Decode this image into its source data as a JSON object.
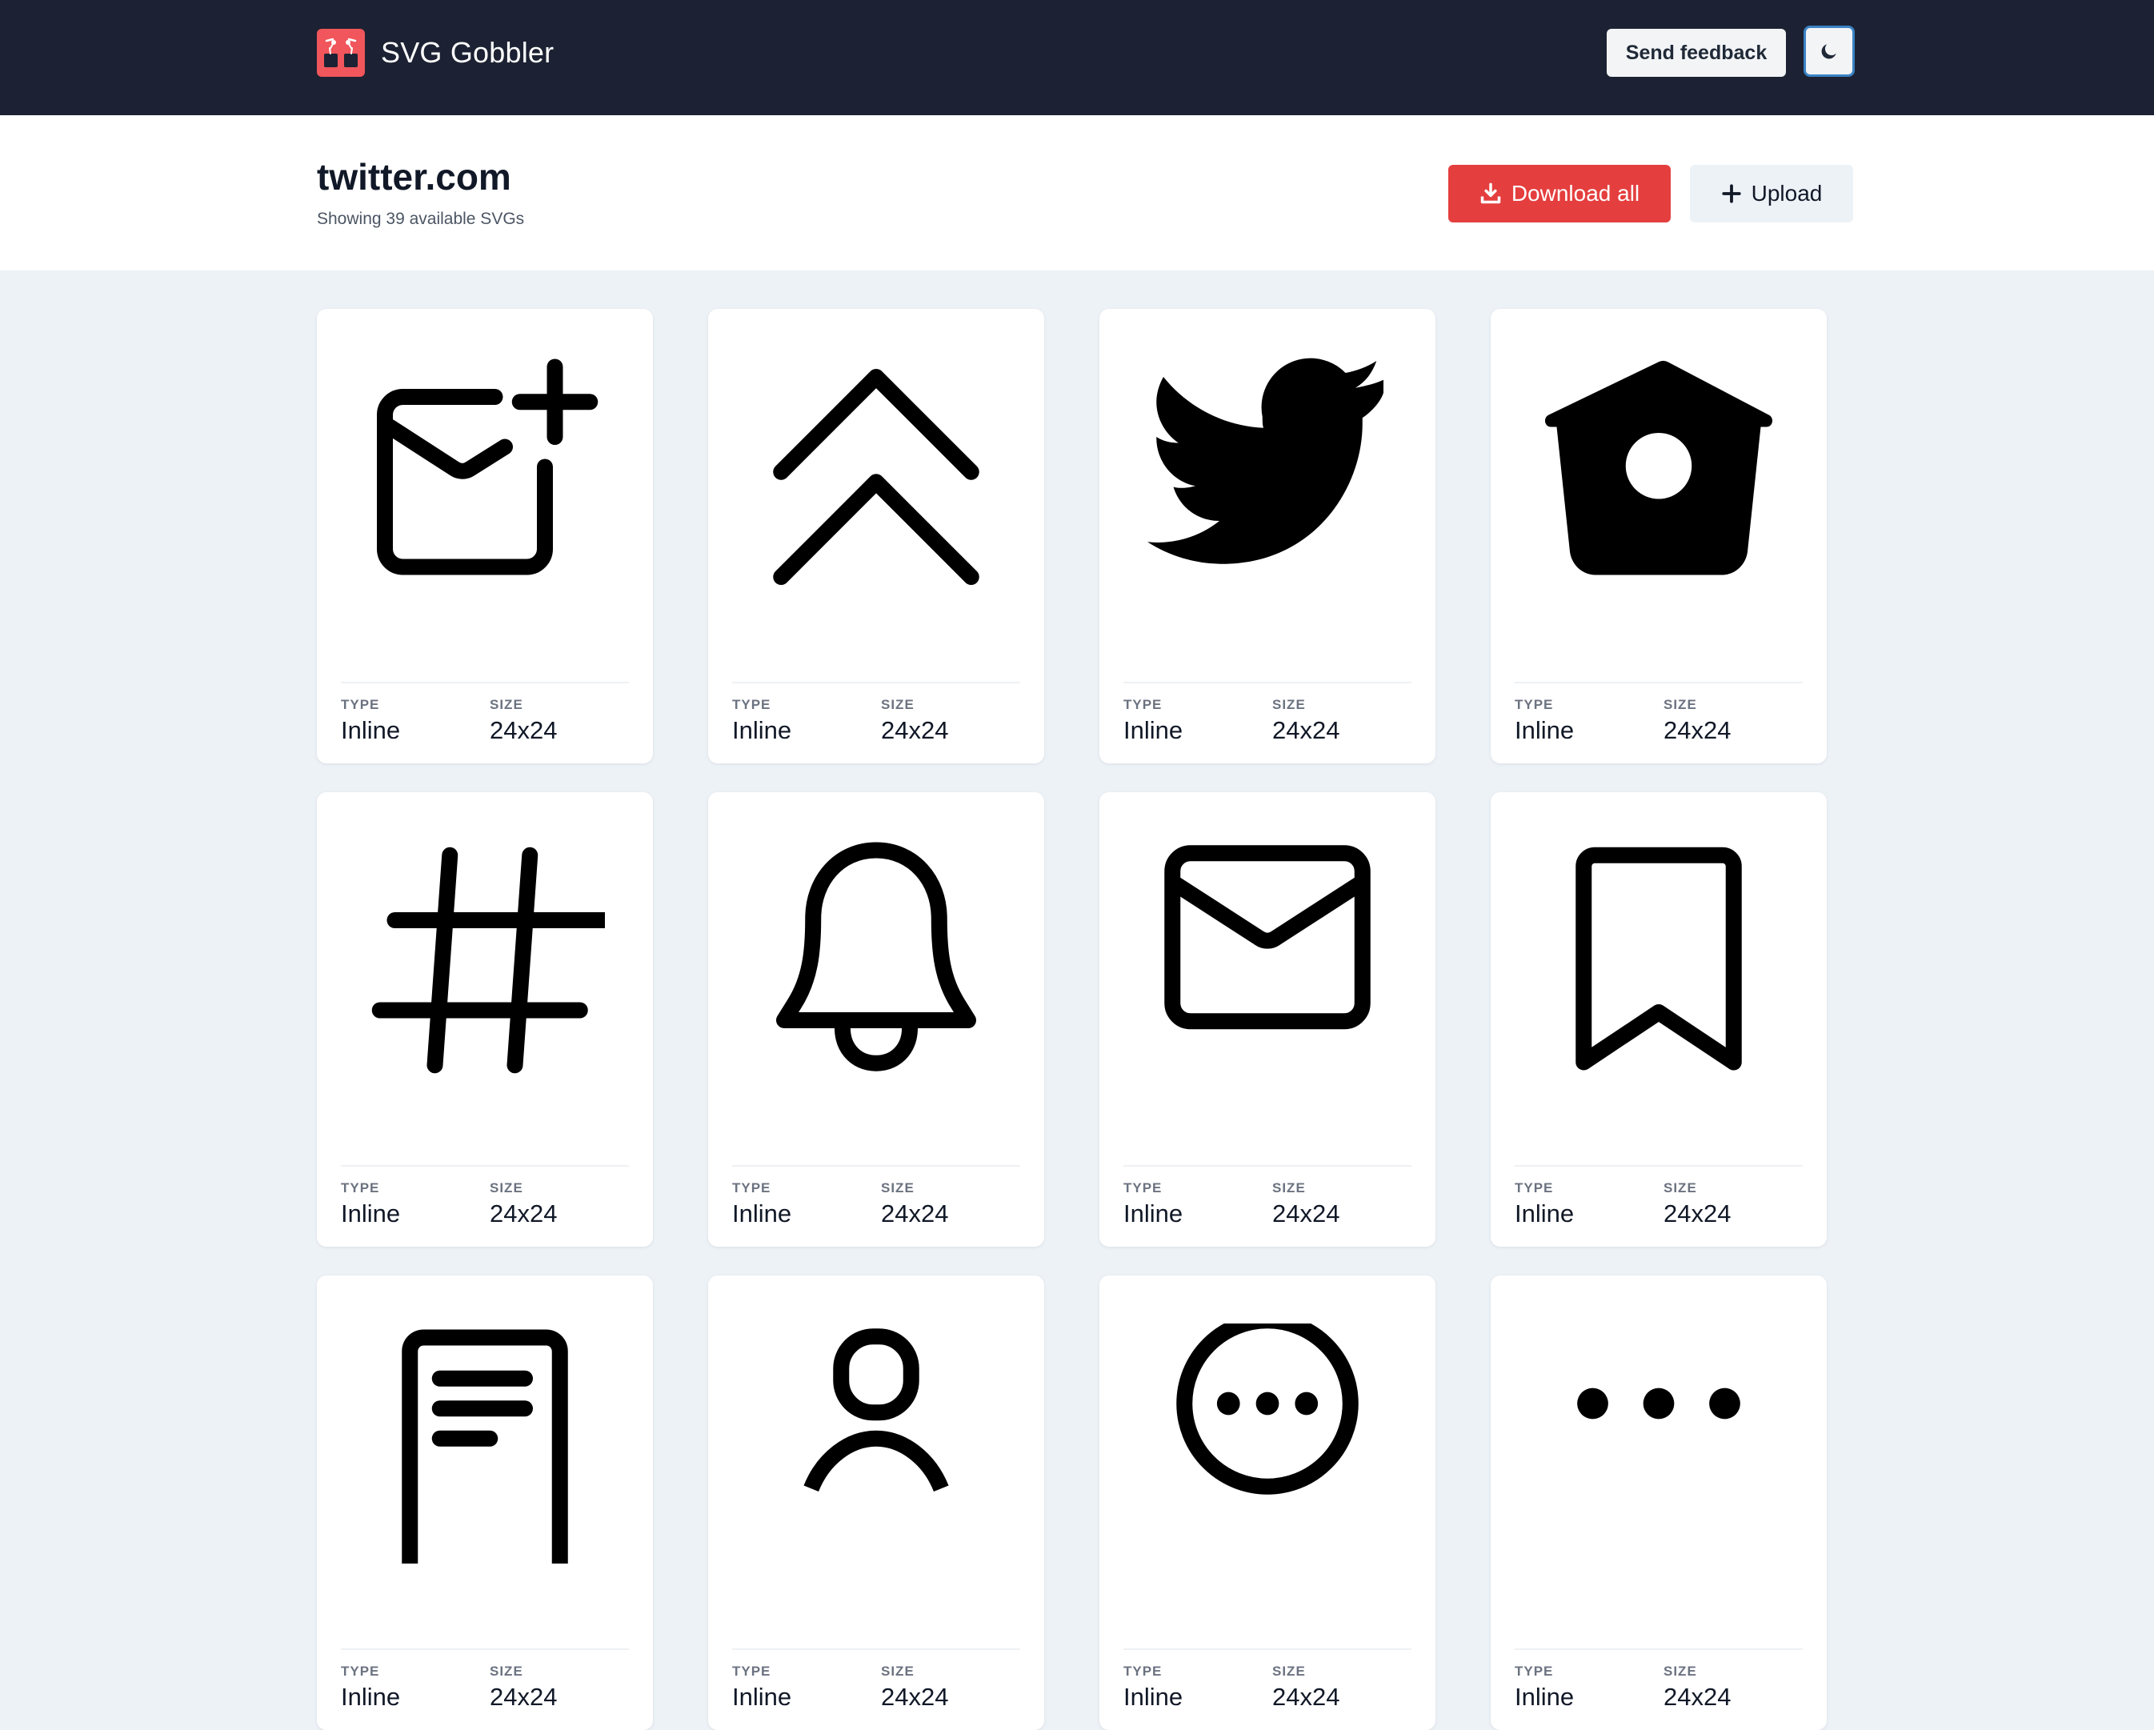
{
  "app": {
    "name": "SVG Gobbler",
    "feedback_label": "Send feedback",
    "theme_icon": "moon-icon"
  },
  "page": {
    "site": "twitter.com",
    "count_text": "Showing 39 available SVGs",
    "download_label": "Download all",
    "upload_label": "Upload"
  },
  "meta_labels": {
    "type": "TYPE",
    "size": "SIZE"
  },
  "cards": [
    {
      "icon": "mail-plus-icon",
      "type": "Inline",
      "size": "24x24"
    },
    {
      "icon": "chevrons-up-icon",
      "type": "Inline",
      "size": "24x24"
    },
    {
      "icon": "twitter-bird-icon",
      "type": "Inline",
      "size": "24x24"
    },
    {
      "icon": "birdhouse-icon",
      "type": "Inline",
      "size": "24x24"
    },
    {
      "icon": "hashtag-icon",
      "type": "Inline",
      "size": "24x24"
    },
    {
      "icon": "bell-icon",
      "type": "Inline",
      "size": "24x24"
    },
    {
      "icon": "mail-icon",
      "type": "Inline",
      "size": "24x24"
    },
    {
      "icon": "bookmark-icon",
      "type": "Inline",
      "size": "24x24"
    },
    {
      "icon": "document-lines-icon",
      "type": "Inline",
      "size": "24x24"
    },
    {
      "icon": "user-icon",
      "type": "Inline",
      "size": "24x24"
    },
    {
      "icon": "chat-dots-icon",
      "type": "Inline",
      "size": "24x24"
    },
    {
      "icon": "more-dots-icon",
      "type": "Inline",
      "size": "24x24"
    }
  ],
  "colors": {
    "header_bg": "#1c2233",
    "accent_red": "#e53e3e",
    "page_bg": "#edf2f7",
    "logo_red": "#f0565b"
  }
}
